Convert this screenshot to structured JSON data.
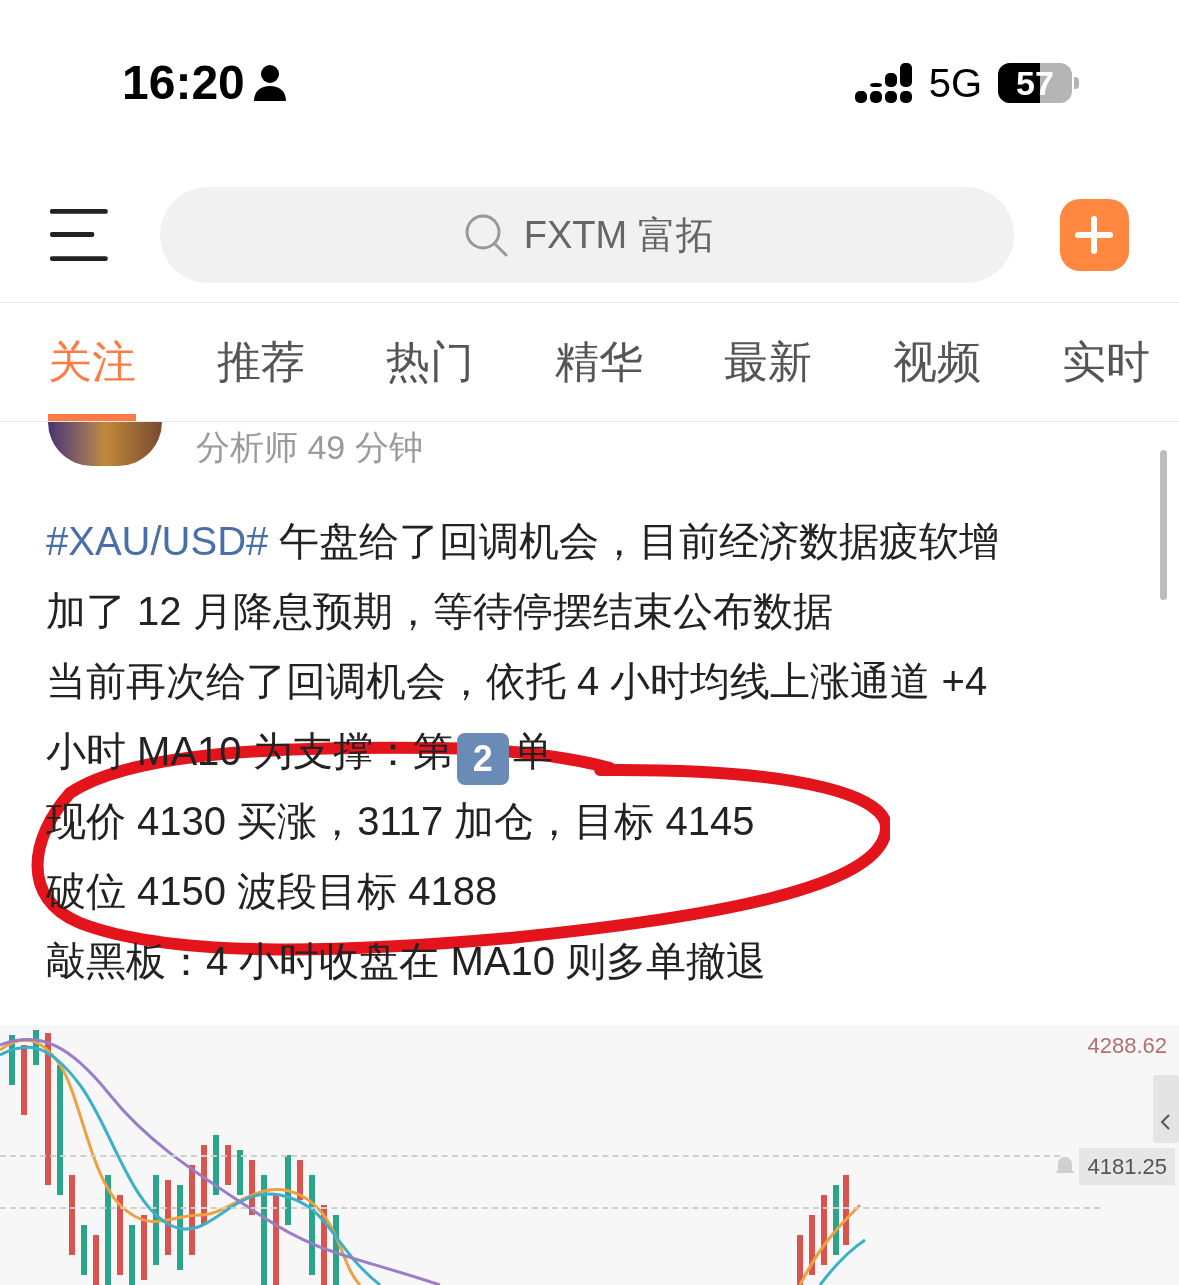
{
  "status_bar": {
    "time": "16:20",
    "network": "5G",
    "battery": "57"
  },
  "search": {
    "placeholder": "FXTM 富拓"
  },
  "tabs": [
    {
      "label": "关注",
      "selected": true
    },
    {
      "label": "推荐",
      "selected": false
    },
    {
      "label": "热门",
      "selected": false
    },
    {
      "label": "精华",
      "selected": false
    },
    {
      "label": "最新",
      "selected": false
    },
    {
      "label": "视频",
      "selected": false
    },
    {
      "label": "实时",
      "selected": false
    }
  ],
  "post": {
    "meta": "分析师 49 分钟",
    "paragraphs": [
      {
        "kind": "hashtag",
        "hashtag": "#XAU/USD#",
        "text": " 午盘给了回调机会，目前经济数据疲软增加了 12 月降息预期，等待停摆结束公布数据"
      },
      {
        "kind": "keycap",
        "text": "当前再次给了回调机会，依托 4 小时均线上涨通道 +4 小时 MA10 为支撑：第",
        "keycap": "2",
        "after": "单"
      },
      {
        "kind": "plain",
        "text": "现价 4130 买涨，3117 加仓，目标 4145"
      },
      {
        "kind": "plain",
        "text": "破位 4150 波段目标 4188"
      },
      {
        "kind": "plain",
        "text": "敲黑板：4 小时收盘在 MA10 则多单撤退"
      }
    ],
    "chart": {
      "price_labels": [
        {
          "kind": "plain",
          "text": "4288.62"
        },
        {
          "kind": "alert",
          "text": "4181.25"
        }
      ]
    }
  }
}
